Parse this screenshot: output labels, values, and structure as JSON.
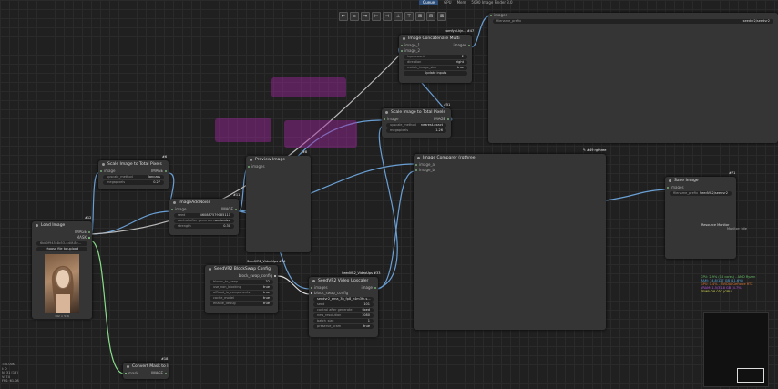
{
  "toolbar": {
    "buttons": [
      "⇤",
      "≡",
      "⇥",
      "⊢",
      "⊣",
      "⊥",
      "⊤",
      "⊞",
      "⊟",
      "⊠"
    ]
  },
  "topbar": {
    "items": [
      "Queue",
      "GPU",
      "Mem",
      "5090 Image Finder 3.0"
    ]
  },
  "nodes": {
    "scale1": {
      "title": "Scale Image to Total Pixels",
      "id": "#6",
      "in": "image",
      "out": "IMAGE",
      "w1_label": "upscale_method",
      "w1_val": "lanczos",
      "w2_label": "megapixels",
      "w2_val": "0.27"
    },
    "load": {
      "title": "Load Image",
      "id": "#12",
      "out1": "IMAGE",
      "out2": "MASK",
      "file": "6bb0f945-4b53-4d4f-8e...",
      "upload": "choose file to upload",
      "dims": "392 × 576"
    },
    "resize": {
      "title": "ImageAddNoise",
      "id": "#11",
      "in": "image",
      "out": "IMAGE",
      "w1_label": "seed",
      "w1_val": "460887579085111",
      "w2_label": "control after generate",
      "w2_val": "randomize",
      "w3_label": "strength",
      "w3_val": "0.30"
    },
    "preview": {
      "title": "Preview Image",
      "id": "#8",
      "in": "images"
    },
    "concat": {
      "title": "Image Concatenate Multi",
      "id": "comfyui-kjn... #47",
      "in1": "image_1",
      "in2": "image_2",
      "out": "images",
      "w1_label": "inputcount",
      "w1_val": "2",
      "w2_label": "direction",
      "w2_val": "right",
      "w3_label": "match_image_size",
      "w3_val": "true",
      "btn": "Update inputs"
    },
    "scale2": {
      "title": "Scale Image to Total Pixels",
      "id": "#51",
      "in": "image",
      "out": "IMAGE",
      "w1_label": "upscale_method",
      "w1_val": "nearest-exact",
      "w2_label": "megapixels",
      "w2_val": "1.26"
    },
    "compare": {
      "title": "Image Comparer (rgthree)",
      "id": "✎ #49 rgthree",
      "in1": "image_a",
      "in2": "image_b"
    },
    "save": {
      "title": "Save Image",
      "id": "#71",
      "in": "images",
      "w1_label": "filename_prefix",
      "w1_val": "SeedVR2/seedvr2"
    },
    "blockswap": {
      "title": "SeedVR2 BlockSwap Config",
      "id": "SeedVR2_VideoUps #34",
      "out": "block_swap_config",
      "w1_label": "blocks_to_swap",
      "w1_val": "32",
      "w2_label": "use_non_blocking",
      "w2_val": "true",
      "w3_label": "offload_io_components",
      "w3_val": "true",
      "w4_label": "cache_model",
      "w4_val": "true",
      "w5_label": "enable_debug",
      "w5_val": "true"
    },
    "upscaler": {
      "title": "SeedVR2 Video Upscaler",
      "id": "SeedVR2_VideoUps #33",
      "in1": "images",
      "in2": "block_swap_config",
      "out": "image",
      "w1_label": "model",
      "w1_val": "seedvr2_ema_3b_fp8_e4m3fn.s...",
      "w2_label": "seed",
      "w2_val": "101",
      "w3_label": "control after generate",
      "w3_val": "fixed",
      "w4_label": "new_resolution",
      "w4_val": "1080",
      "w5_label": "batch_size",
      "w5_val": "1",
      "w6_label": "preserve_vram",
      "w6_val": "true"
    },
    "convert": {
      "title": "Convert Mask to I",
      "id": "#18",
      "in": "mask",
      "out": "IMAGE"
    },
    "topsave": {
      "in": "images",
      "w1_label": "filename_prefix",
      "w1_val": "seedvr2/seedvr2"
    }
  },
  "monitor": {
    "title": "Resource Monitor",
    "status": "Monitor: Idle"
  },
  "stats": [
    "CPU: 2.9% (16 cores) - AMD Ryzen",
    "RAM: 14.8/127 GB (11.6%)",
    "GPU: 0.4% - NVIDIA GeForce RTX",
    "VRAM: 1.5/31.8 GB (4.7%)",
    "TEMP: 28.0°C (GPU)"
  ],
  "corner": [
    "T: 0.00s",
    "I: 0",
    "N: 31 [15]",
    "V: 74",
    "FPS: 61.08"
  ],
  "colors": {
    "cpu": "#66bb66",
    "ram": "#55aadd",
    "gpu": "#dd7733",
    "vram": "#bb55dd",
    "temp": "#dddd55"
  }
}
